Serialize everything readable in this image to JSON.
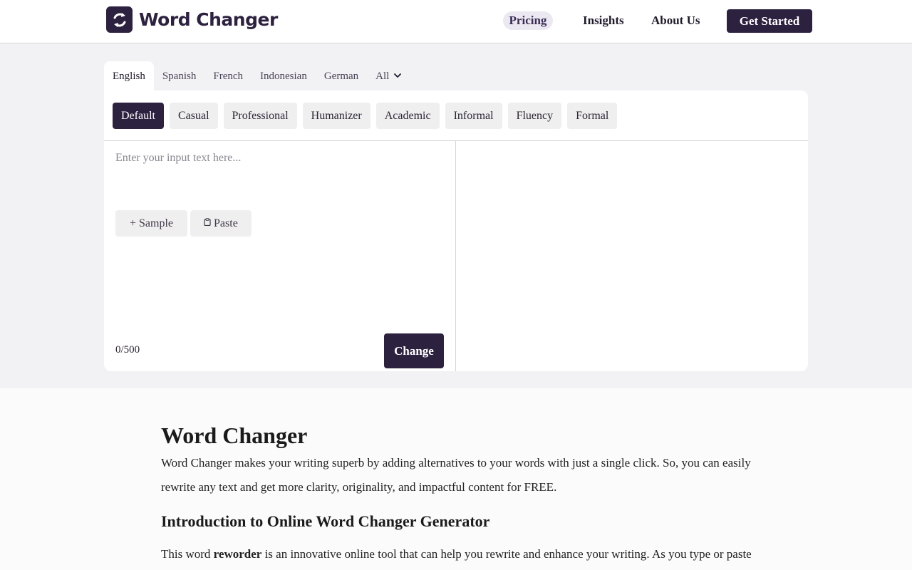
{
  "header": {
    "brand": "Word Changer",
    "nav": [
      "Pricing",
      "Insights",
      "About Us"
    ],
    "cta": "Get Started"
  },
  "languages": {
    "items": [
      "English",
      "Spanish",
      "French",
      "Indonesian",
      "German"
    ],
    "active": "English",
    "more": "All"
  },
  "modes": {
    "items": [
      "Default",
      "Casual",
      "Professional",
      "Humanizer",
      "Academic",
      "Informal",
      "Fluency",
      "Formal"
    ],
    "active": "Default"
  },
  "editor": {
    "placeholder": "Enter your input text here...",
    "sample_label": "+ Sample",
    "paste_label": "Paste",
    "counter": "0/500",
    "change_label": "Change"
  },
  "article": {
    "title": "Word Changer",
    "intro": "Word Changer makes your writing superb by adding alternatives to your words with just a single click. So, you can easily rewrite any text and get more clarity, originality, and impactful content for FREE.",
    "subtitle": "Introduction to Online Word Changer Generator",
    "para_before": "This word ",
    "para_bold": "reworder",
    "para_after": " is an innovative online tool that can help you rewrite and enhance your writing. As you type or paste"
  },
  "colors": {
    "brand": "#2d2140",
    "page_bg": "#f2f1f4",
    "chip_bg": "#efefef"
  },
  "icons": {
    "logo": "refresh-arrows-icon",
    "all_dropdown": "chevron-down-icon",
    "paste": "clipboard-icon"
  }
}
